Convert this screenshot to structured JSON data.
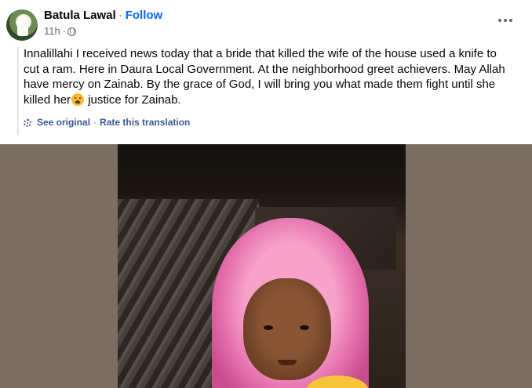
{
  "post": {
    "author": "Batula Lawal",
    "separator": "·",
    "follow_label": "Follow",
    "time": "11h",
    "dot": "·",
    "text_before_emoji": "Innalillahi I received news today that a bride that killed the wife of the house used a knife to cut a ram. Here in Daura Local Government. At the neighborhood greet achievers. May Allah have mercy on Zainab. By the grace of God, I will bring you what made them fight until she killed her",
    "text_after_emoji": " justice for Zainab.",
    "see_original": "See original",
    "translation_sep": "·",
    "rate_translation": "Rate this translation"
  },
  "colors": {
    "link_blue": "#0866ff",
    "translation_blue": "#385898",
    "secondary_text": "#65676b",
    "photo_background": "#7a6e63"
  },
  "icons": {
    "privacy": "globe-icon",
    "more": "more-options-icon",
    "translation": "gear-icon",
    "emoji": "crying-face-emoji"
  }
}
